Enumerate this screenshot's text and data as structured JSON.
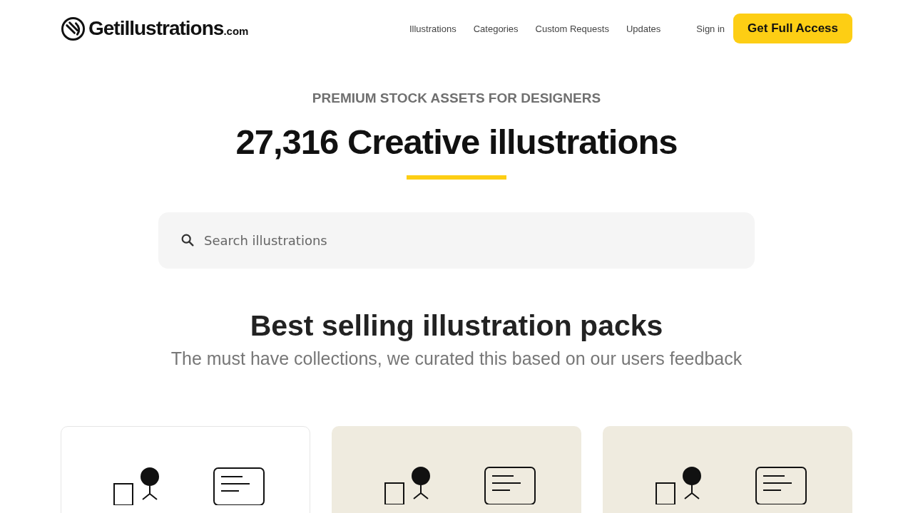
{
  "header": {
    "logo": {
      "name": "Getillustrations",
      "suffix": ".com"
    },
    "nav": [
      {
        "label": "Illustrations"
      },
      {
        "label": "Categories"
      },
      {
        "label": "Custom Requests"
      },
      {
        "label": "Updates"
      }
    ],
    "sign_in": "Sign in",
    "cta": "Get Full Access"
  },
  "hero": {
    "eyebrow": "PREMIUM STOCK ASSETS FOR DESIGNERS",
    "title": "27,316 Creative illustrations",
    "search": {
      "placeholder": "Search illustrations"
    }
  },
  "section": {
    "title": "Best selling illustration packs",
    "subtitle": "The must have collections, we curated this based on our users feedback",
    "cards": [
      {
        "kind": "plain"
      },
      {
        "kind": "tinted"
      },
      {
        "kind": "tinted"
      }
    ]
  }
}
